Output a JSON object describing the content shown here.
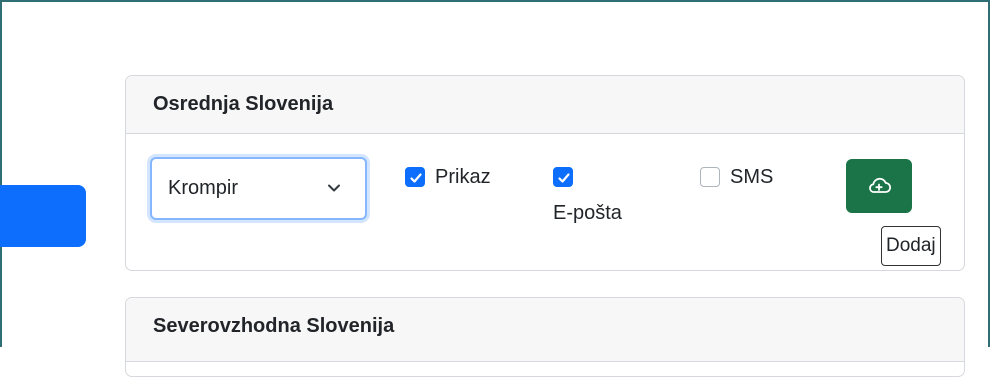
{
  "regions": [
    {
      "title": "Osrednja Slovenija",
      "product_select": {
        "selected": "Krompir"
      },
      "options": [
        {
          "label": "Prikaz",
          "checked": true
        },
        {
          "label": "E-pošta",
          "checked": true
        },
        {
          "label": "SMS",
          "checked": false
        }
      ],
      "add_button": {
        "icon": "cloud-plus-icon",
        "tooltip": "Dodaj"
      }
    },
    {
      "title": "Severovzhodna Slovenija"
    }
  ],
  "colors": {
    "primary": "#0d6efd",
    "success": "#1a7447",
    "focus_border": "#86b7fe",
    "frame": "#2f6f74"
  }
}
